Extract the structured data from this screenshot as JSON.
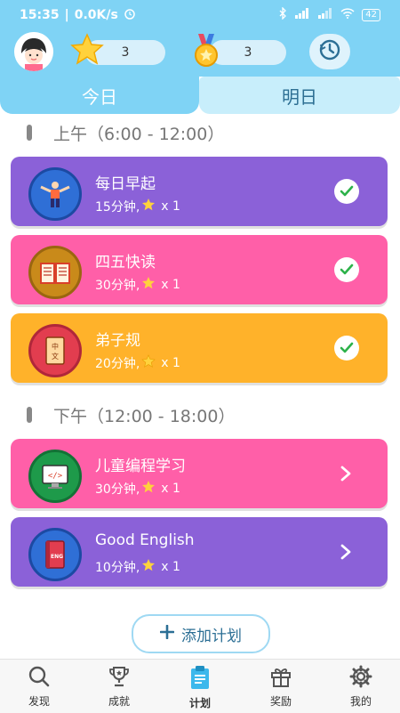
{
  "status_bar": {
    "time": "15:35",
    "speed": "0.0K/s",
    "battery": "42"
  },
  "header": {
    "stars_count": "3",
    "medals_count": "3"
  },
  "tabs": [
    {
      "label": "今日",
      "active": true
    },
    {
      "label": "明日",
      "active": false
    }
  ],
  "sections": [
    {
      "title": "上午（6:00 - 12:00）",
      "tasks": [
        {
          "title": "每日早起",
          "meta": "15分钟,",
          "reward": "x 1",
          "done": true,
          "icon": "exercise-icon"
        },
        {
          "title": "四五快读",
          "meta": "30分钟,",
          "reward": "x 1",
          "done": true,
          "icon": "book-icon"
        },
        {
          "title": "弟子规",
          "meta": "20分钟,",
          "reward": "x 1",
          "done": true,
          "icon": "chinese-book-icon"
        }
      ]
    },
    {
      "title": "下午（12:00 - 18:00）",
      "tasks": [
        {
          "title": "儿童编程学习",
          "meta": "30分钟,",
          "reward": "x 1",
          "done": false,
          "icon": "code-icon"
        },
        {
          "title": "Good English",
          "meta": "10分钟,",
          "reward": "x 1",
          "done": false,
          "icon": "english-book-icon"
        }
      ]
    }
  ],
  "add_button": {
    "label": "添加计划"
  },
  "bottom_nav": [
    {
      "label": "发现",
      "icon": "search-icon"
    },
    {
      "label": "成就",
      "icon": "trophy-icon"
    },
    {
      "label": "计划",
      "icon": "clipboard-icon",
      "active": true
    },
    {
      "label": "奖励",
      "icon": "gift-icon"
    },
    {
      "label": "我的",
      "icon": "gear-icon"
    }
  ],
  "colors": {
    "header": "#7fd3f5",
    "purple": "#8b61d8",
    "pink": "#ff5fa8",
    "orange": "#ffb22a"
  }
}
